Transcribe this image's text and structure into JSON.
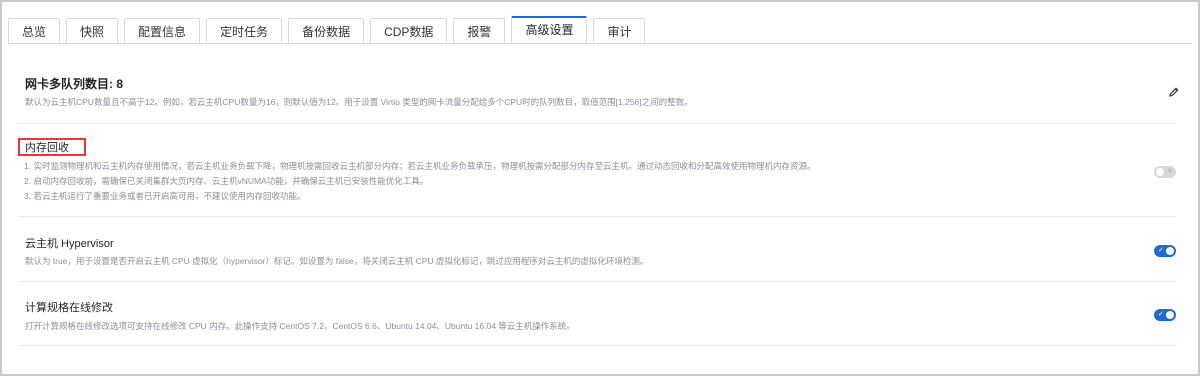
{
  "tabs": [
    {
      "label": "总览"
    },
    {
      "label": "快照"
    },
    {
      "label": "配置信息"
    },
    {
      "label": "定时任务"
    },
    {
      "label": "备份数据"
    },
    {
      "label": "CDP数据"
    },
    {
      "label": "报警"
    },
    {
      "label": "高级设置",
      "active": true
    },
    {
      "label": "审计"
    }
  ],
  "settings": {
    "nic_queue": {
      "title": "网卡多队列数目: 8",
      "desc": "默认为云主机CPU数量且不高于12。例如，若云主机CPU数量为16，则默认值为12。用于设置 Virtio 类型的网卡流量分配给多个CPU时的队列数目，取值范围[1,256]之间的整数。",
      "icon": "pencil-icon"
    },
    "memory_reclaim": {
      "title": "内存回收",
      "desc1": "1. 实时监测物理机和云主机内存使用情况，若云主机业务负载下降，物理机按需回收云主机部分内存；若云主机业务负载承压，物理机按需分配部分内存至云主机。通过动态回收和分配高效使用物理机内存资源。",
      "desc2": "2. 启动内存回收前，需确保已关闭集群大页内存、云主机vNUMA功能，并确保云主机已安装性能优化工具。",
      "desc3": "3. 若云主机运行了重要业务或者已开启高可用，不建议使用内存回收功能。",
      "enabled": false,
      "toggle_mark": "✕"
    },
    "hypervisor": {
      "title": "云主机 Hypervisor",
      "desc": "默认为 true，用于设置是否开启云主机 CPU 虚拟化（hypervisor）标记。如设置为 false，将关闭云主机 CPU 虚拟化标记，跳过应用程序对云主机的虚拟化环境检测。",
      "enabled": true,
      "toggle_mark": "✓"
    },
    "online_resize": {
      "title": "计算规格在线修改",
      "desc": "打开计算规格在线修改选项可支持在线修改 CPU 内存。此操作支持 CentOS 7.2、CentOS 6.6、Ubuntu 14.04、Ubuntu 16.04 等云主机操作系统。",
      "enabled": true,
      "toggle_mark": "✓"
    }
  },
  "colors": {
    "accent": "#1f6ad1",
    "highlight": "#e53935",
    "toggle_off": "#d6d8dc"
  }
}
